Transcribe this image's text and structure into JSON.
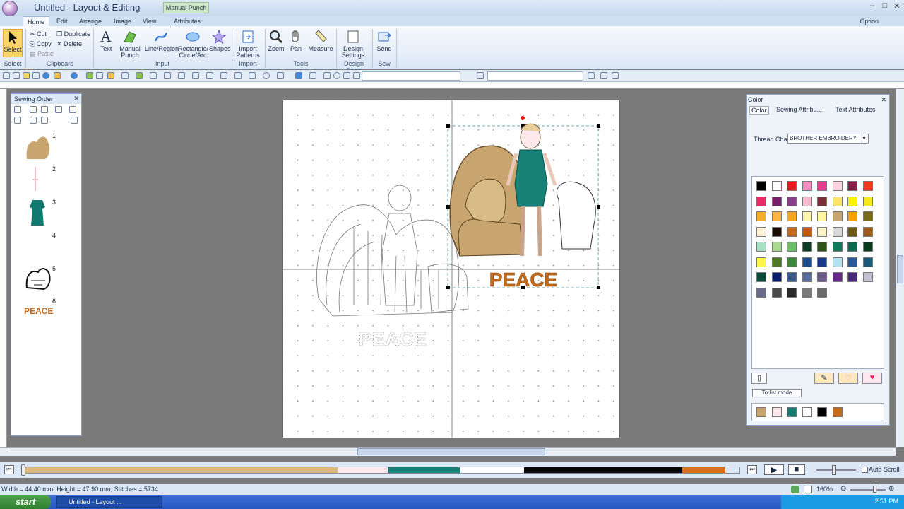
{
  "window": {
    "title": "Untitled - Layout & Editing",
    "context_tab": "Manual Punch"
  },
  "tabs": [
    "Home",
    "Edit",
    "Arrange",
    "Image",
    "View",
    "Attributes"
  ],
  "option_label": "Option",
  "ribbon": {
    "select_label": "Select",
    "clipboard": {
      "cut": "Cut",
      "copy": "Copy",
      "paste": "Paste",
      "duplicate": "Duplicate",
      "delete": "Delete"
    },
    "text_label": "Text",
    "manual_punch_label": "Manual Punch",
    "line_region_label": "Line/Region",
    "rect_circle_label": "Rectangle/ Circle/Arc",
    "shapes_label": "Shapes",
    "import_patterns_label": "Import Patterns",
    "zoom_label": "Zoom",
    "pan_label": "Pan",
    "measure_label": "Measure",
    "design_settings_label": "Design Settings",
    "send_label": "Send",
    "groups": {
      "select": "Select",
      "clipboard": "Clipboard",
      "input": "Input",
      "import": "Import",
      "tools": "Tools",
      "design_page": "Design Page",
      "sew": "Sew"
    }
  },
  "sewing_order": {
    "title": "Sewing Order",
    "items": [
      {
        "num": "1",
        "color": "#c8a46e"
      },
      {
        "num": "2",
        "color": "#f5c7cf"
      },
      {
        "num": "3",
        "color": "#1e7a70"
      },
      {
        "num": "4",
        "color": "#ffffff"
      },
      {
        "num": "5",
        "color": "#222222"
      },
      {
        "num": "6",
        "label": "PEACE",
        "color": "#c46a1a"
      }
    ]
  },
  "canvas": {
    "design_text": "PEACE",
    "ghost_text": "PEACE"
  },
  "color_panel": {
    "title": "Color",
    "tabs": [
      "Color",
      "Sewing Attribu...",
      "Text Attributes"
    ],
    "thread_chart_label": "Thread Chart:",
    "thread_chart_value": "BROTHER EMBROIDERY",
    "palette": [
      "#000000",
      "#ffffff",
      "#e8141e",
      "#f78bc0",
      "#ec3b8e",
      "#fbd3df",
      "#8a1d4a",
      "#f03c1e",
      "#ea2b6a",
      "#7a1e6b",
      "#8a3b8a",
      "#f8bcd0",
      "#7c2e35",
      "#ffe566",
      "#fff200",
      "#f6e91a",
      "#f6ad2a",
      "#ffb342",
      "#f5a623",
      "#fff5b0",
      "#fff59a",
      "#c8a46e",
      "#f5a100",
      "#7a6b1a",
      "#fff1d6",
      "#1a0a00",
      "#c46a1a",
      "#c45a10",
      "#fff3c8",
      "#d9d9d9",
      "#6b5a10",
      "#9e5a1c",
      "#a8e0c4",
      "#a9d98f",
      "#6ac06a",
      "#0e3b26",
      "#2e5418",
      "#117a5e",
      "#0d6b52",
      "#0a3a1e",
      "#fff44a",
      "#4e7a22",
      "#3b8a3b",
      "#1f4e8c",
      "#173a8a",
      "#b0e2f0",
      "#2a5a9a",
      "#1d5a78",
      "#0a4a3a",
      "#0a1a6b",
      "#3a5a8a",
      "#5a6a9a",
      "#6a5a8a",
      "#6a2a8a",
      "#4a2a7a",
      "#c0c0d0",
      "#6a6a8a",
      "#4a4a4a",
      "#2a2a2a",
      "#7a7a7a",
      "#6b6b6b"
    ],
    "to_list_mode": "To list mode",
    "used_colors": [
      "#c8a46e",
      "#fbe7ea",
      "#117a70",
      "#ffffff",
      "#000000",
      "#c46a1a"
    ]
  },
  "timeline": {
    "segments": [
      {
        "color": "#dcb87c",
        "fraction": 0.44
      },
      {
        "color": "#fde9ec",
        "fraction": 0.07
      },
      {
        "color": "#168176",
        "fraction": 0.1
      },
      {
        "color": "#ffffff",
        "fraction": 0.09
      },
      {
        "color": "#080808",
        "fraction": 0.22
      },
      {
        "color": "#d9701e",
        "fraction": 0.06
      }
    ],
    "auto_scroll": "Auto Scroll"
  },
  "status": {
    "info": "Width = 44.40 mm, Height = 47.90 mm, Stitches = 5734",
    "zoom": "160%"
  },
  "taskbar": {
    "start": "start",
    "task": "Untitled - Layout ...",
    "clock": "2:51 PM"
  }
}
